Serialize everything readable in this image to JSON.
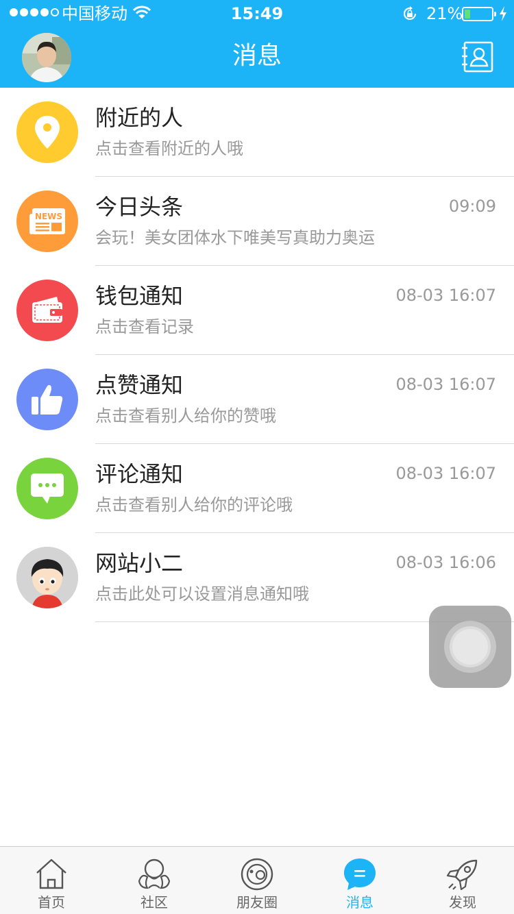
{
  "status_bar": {
    "carrier": "中国移动",
    "time": "15:49",
    "battery_percent": "21%",
    "battery_level": 0.21,
    "signal_bars": 4,
    "signal_total": 5
  },
  "header": {
    "title": "消息",
    "avatar_icon": "user-avatar",
    "action_icon": "contacts-icon"
  },
  "messages": [
    {
      "title": "附近的人",
      "subtitle": "点击查看附近的人哦",
      "time": "",
      "icon": "location-pin-icon",
      "color": "#ffcb2f"
    },
    {
      "title": "今日头条",
      "subtitle": "会玩！美女团体水下唯美写真助力奥运",
      "time": "09:09",
      "icon": "news-icon",
      "color": "#ff9c3a"
    },
    {
      "title": "钱包通知",
      "subtitle": "点击查看记录",
      "time": "08-03 16:07",
      "icon": "wallet-icon",
      "color": "#f24a4e"
    },
    {
      "title": "点赞通知",
      "subtitle": "点击查看别人给你的赞哦",
      "time": "08-03 16:07",
      "icon": "thumbs-up-icon",
      "color": "#6d8cf8"
    },
    {
      "title": "评论通知",
      "subtitle": "点击查看别人给你的评论哦",
      "time": "08-03 16:07",
      "icon": "comment-icon",
      "color": "#79d33c"
    },
    {
      "title": "网站小二",
      "subtitle": "点击此处可以设置消息通知哦",
      "time": "08-03 16:06",
      "icon": "cartoon-avatar-icon",
      "color": "#c9c9c9"
    }
  ],
  "tabs": [
    {
      "label": "首页",
      "icon": "home-icon",
      "active": false
    },
    {
      "label": "社区",
      "icon": "community-icon",
      "active": false
    },
    {
      "label": "朋友圈",
      "icon": "moments-icon",
      "active": false
    },
    {
      "label": "消息",
      "icon": "message-bubble-icon",
      "active": true
    },
    {
      "label": "发现",
      "icon": "rocket-icon",
      "active": false
    }
  ],
  "colors": {
    "accent": "#1cb4f7",
    "divider": "#d8d8d8",
    "subtext": "#999999"
  }
}
